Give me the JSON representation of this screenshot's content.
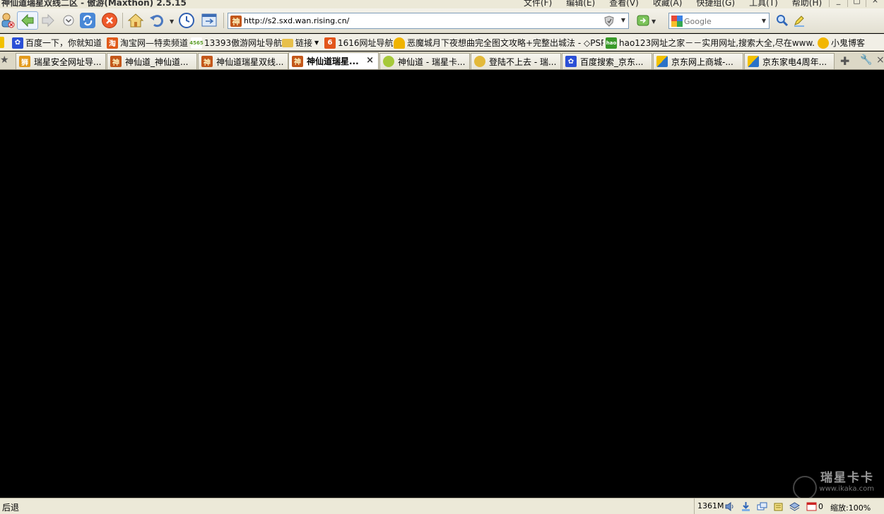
{
  "window": {
    "title": "神仙道瑞星双线二区 - 傲游(Maxthon) 2.5.15",
    "menu": [
      "文件(F)",
      "编辑(E)",
      "查看(V)",
      "收藏(A)",
      "快捷组(G)",
      "工具(T)",
      "帮助(H)"
    ]
  },
  "toolbar": {
    "address": "http://s2.sxd.wan.rising.cn/",
    "search_placeholder": "Google"
  },
  "bookmarks": [
    {
      "label": "百度一下，你就知道",
      "icon": "paw-icon",
      "color": "#2b4fd6"
    },
    {
      "label": "淘宝网—特卖频道",
      "icon": "taobao-icon",
      "color": "#e05a1a"
    },
    {
      "label": "13393傲游网址导航",
      "icon": "4565-icon",
      "color": "#5f9e2a"
    },
    {
      "label": "链接",
      "icon": "folder-icon",
      "color": "#e8c04a"
    },
    {
      "label": "1616网址导航",
      "icon": "1616-icon",
      "color": "#e2551b"
    },
    {
      "label": "恶魔城月下夜想曲完全图文攻略+完整出城法 - ◇PSP...",
      "icon": "cup-icon",
      "color": "#f0b400"
    },
    {
      "label": "hao123网址之家－－实用网址,搜索大全,尽在www.ha...",
      "icon": "hao-icon",
      "color": "#3a9a2a"
    },
    {
      "label": "小鬼博客",
      "icon": "hand-icon",
      "color": "#f2b600"
    }
  ],
  "tabs": [
    {
      "label": "瑞星安全网址导...",
      "icon": "lion-icon",
      "color": "#e39a1c",
      "active": false
    },
    {
      "label": "神仙道_神仙道...",
      "icon": "shen-icon",
      "color": "#c3571a",
      "active": false
    },
    {
      "label": "神仙道瑞星双线...",
      "icon": "shen-icon",
      "color": "#c3571a",
      "active": false
    },
    {
      "label": "神仙道瑞星...",
      "icon": "shen-icon",
      "color": "#c3571a",
      "active": true
    },
    {
      "label": "神仙道 - 瑞星卡...",
      "icon": "leaf-icon",
      "color": "#a6c93a",
      "active": false
    },
    {
      "label": "登陆不上去 - 瑞...",
      "icon": "smile-icon",
      "color": "#e3b93a",
      "active": false
    },
    {
      "label": "百度搜索_京东...",
      "icon": "paw-icon",
      "color": "#2b4fd6",
      "active": false
    },
    {
      "label": "京东网上商城-...",
      "icon": "jd-icon",
      "color": "#2a72c8",
      "active": false
    },
    {
      "label": "京东家电4周年...",
      "icon": "jd-icon",
      "color": "#2a72c8",
      "active": false
    }
  ],
  "watermark": {
    "line1": "瑞星卡卡",
    "line2": "www.ikaka.com"
  },
  "statusbar": {
    "status": "后退",
    "memory": "1361M",
    "count": "0",
    "zoom": "缩放:100%"
  }
}
